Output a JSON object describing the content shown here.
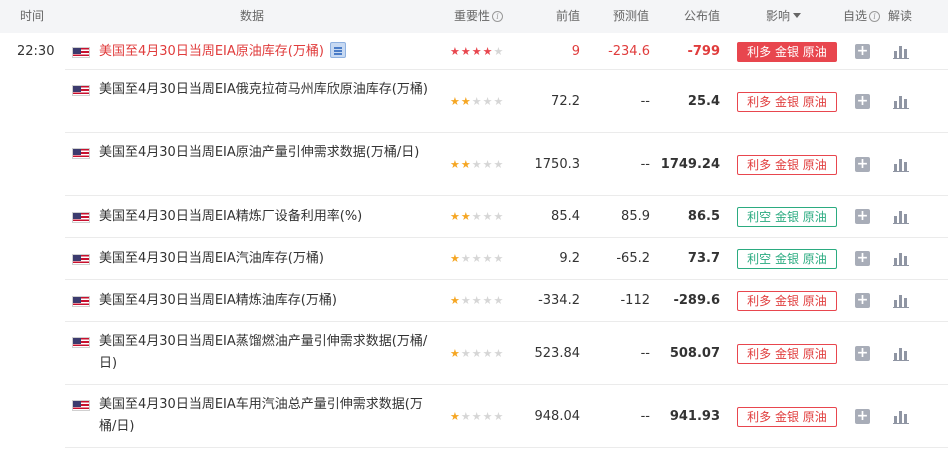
{
  "header": {
    "time": "时间",
    "data": "数据",
    "importance": "重要性",
    "previous": "前值",
    "forecast": "预测值",
    "actual": "公布值",
    "impact": "影响",
    "favorite": "自选",
    "interpret": "解读"
  },
  "rows": [
    {
      "time": "22:30",
      "name": "美国至4月30日当周EIA原油库存(万桶)",
      "highlight": true,
      "stars": 4,
      "previous": "9",
      "forecast": "-234.6",
      "actual": "-799",
      "impact": "利多 金银 原油",
      "impact_style": "solid"
    },
    {
      "time": "",
      "name": "美国至4月30日当周EIA俄克拉荷马州库欣原油库存(万桶)",
      "stars": 2,
      "previous": "72.2",
      "forecast": "--",
      "actual": "25.4",
      "impact": "利多 金银 原油",
      "impact_style": "bull"
    },
    {
      "time": "",
      "name": "美国至4月30日当周EIA原油产量引伸需求数据(万桶/日)",
      "stars": 2,
      "previous": "1750.3",
      "forecast": "--",
      "actual": "1749.24",
      "impact": "利多 金银 原油",
      "impact_style": "bull"
    },
    {
      "time": "",
      "name": "美国至4月30日当周EIA精炼厂设备利用率(%)",
      "stars": 2,
      "previous": "85.4",
      "forecast": "85.9",
      "actual": "86.5",
      "impact": "利空 金银 原油",
      "impact_style": "bear"
    },
    {
      "time": "",
      "name": "美国至4月30日当周EIA汽油库存(万桶)",
      "stars": 1,
      "previous": "9.2",
      "forecast": "-65.2",
      "actual": "73.7",
      "impact": "利空 金银 原油",
      "impact_style": "bear"
    },
    {
      "time": "",
      "name": "美国至4月30日当周EIA精炼油库存(万桶)",
      "stars": 1,
      "previous": "-334.2",
      "forecast": "-112",
      "actual": "-289.6",
      "impact": "利多 金银 原油",
      "impact_style": "bull"
    },
    {
      "time": "",
      "name": "美国至4月30日当周EIA蒸馏燃油产量引伸需求数据(万桶/日)",
      "stars": 1,
      "previous": "523.84",
      "forecast": "--",
      "actual": "508.07",
      "impact": "利多 金银 原油",
      "impact_style": "bull"
    },
    {
      "time": "",
      "name": "美国至4月30日当周EIA车用汽油总产量引伸需求数据(万桶/日)",
      "stars": 1,
      "previous": "948.04",
      "forecast": "--",
      "actual": "941.93",
      "impact": "利多 金银 原油",
      "impact_style": "bull"
    }
  ],
  "colors": {
    "bullish": "#e8464e",
    "bearish": "#2bab80",
    "header_bg": "#f4f5f7"
  },
  "icons": {
    "flag": "us-flag-icon",
    "doc": "document-icon",
    "add": "plus-icon",
    "chart": "bar-chart-icon",
    "info": "info-icon",
    "sort": "caret-down-icon"
  }
}
